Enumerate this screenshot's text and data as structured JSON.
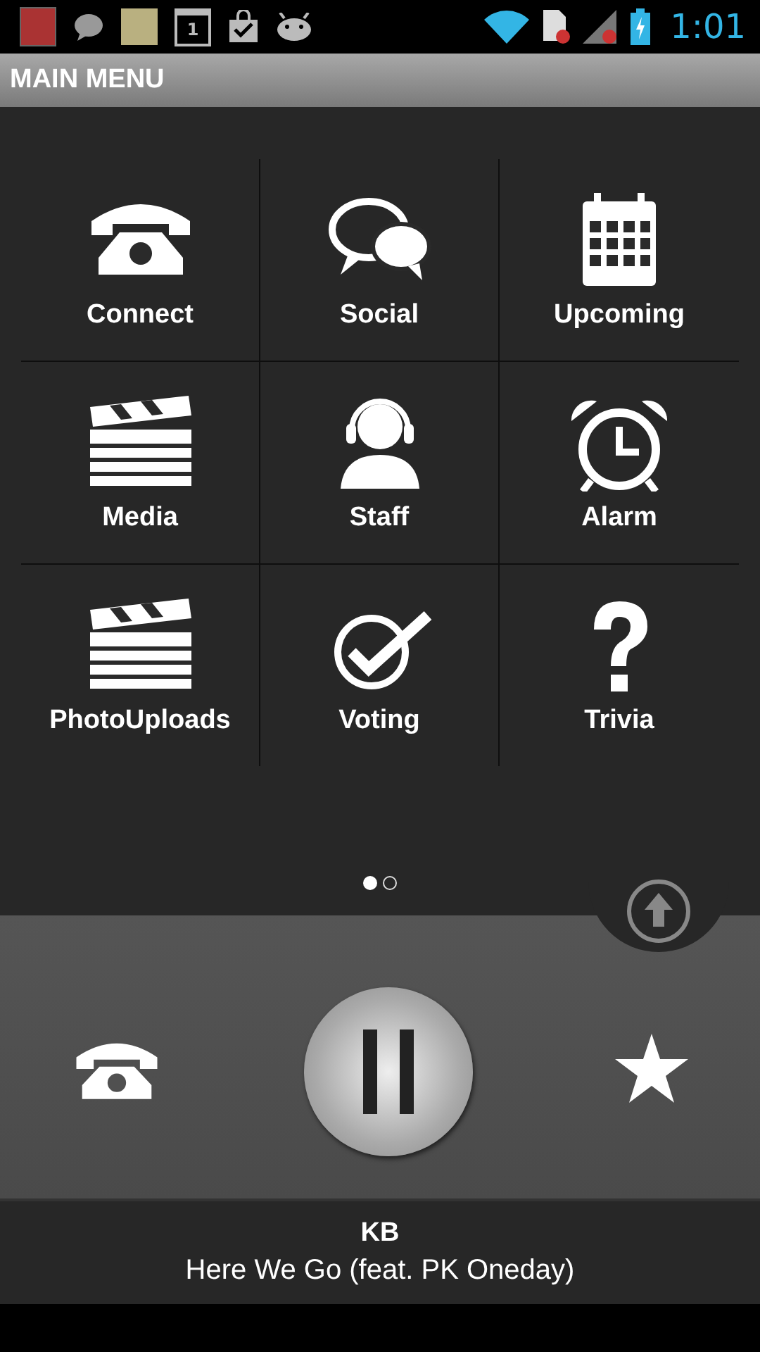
{
  "status_bar": {
    "calendar_day": "1",
    "time": "1:01"
  },
  "title": "MAIN MENU",
  "menu": [
    {
      "label": "Connect"
    },
    {
      "label": "Social"
    },
    {
      "label": "Upcoming"
    },
    {
      "label": "Media"
    },
    {
      "label": "Staff"
    },
    {
      "label": "Alarm"
    },
    {
      "label": "PhotoUploads"
    },
    {
      "label": "Voting"
    },
    {
      "label": "Trivia"
    }
  ],
  "pages": [
    {
      "selected": true
    },
    {
      "selected": false
    }
  ],
  "now_playing": {
    "artist": "KB",
    "track": "Here We Go (feat. PK Oneday)"
  }
}
